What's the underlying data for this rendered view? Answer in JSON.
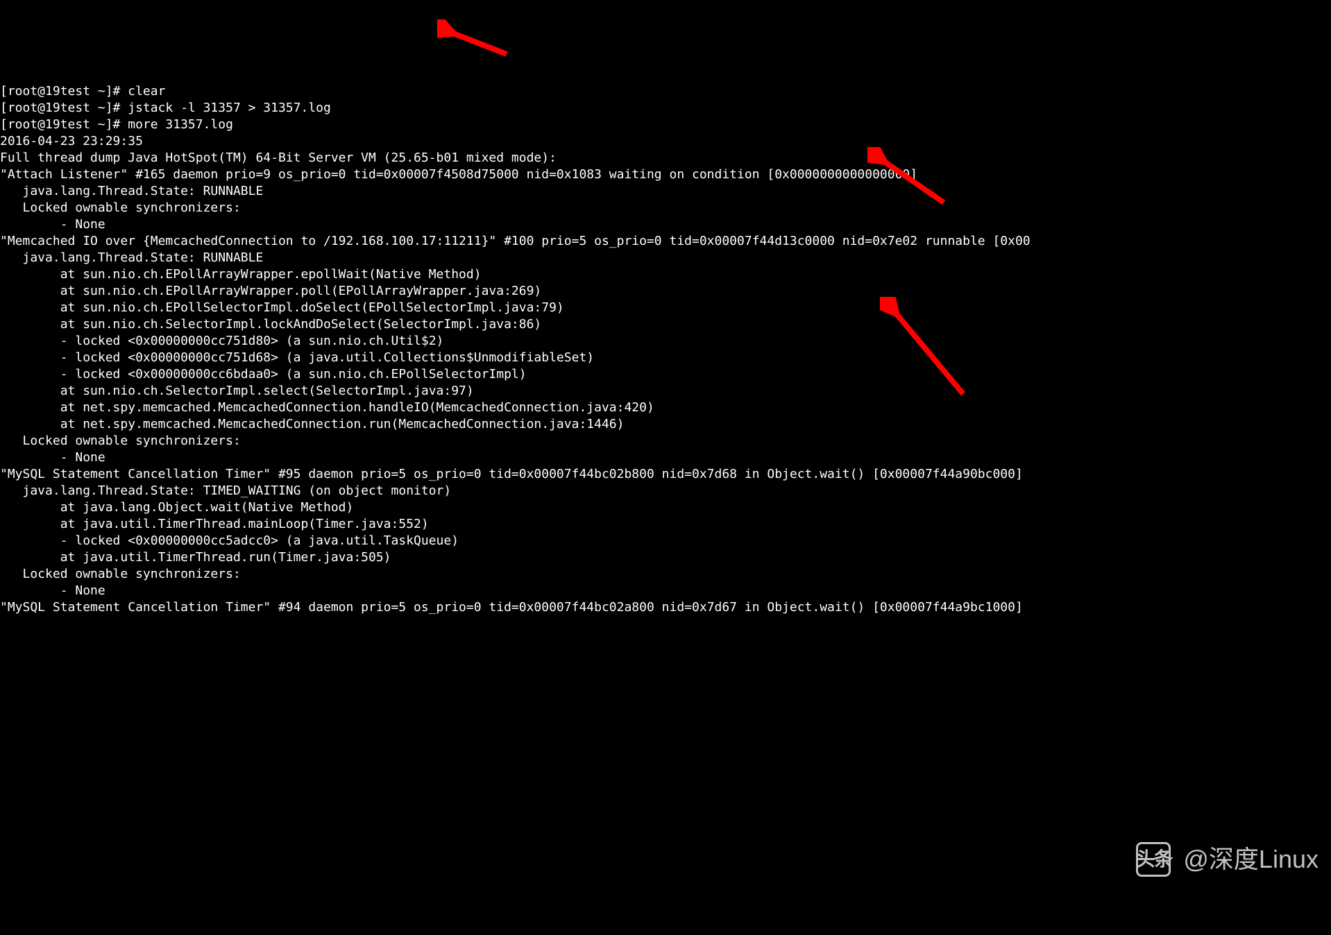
{
  "terminal": {
    "lines": [
      "[root@19test ~]# clear",
      "[root@19test ~]# jstack -l 31357 > 31357.log",
      "[root@19test ~]# more 31357.log",
      "2016-04-23 23:29:35",
      "Full thread dump Java HotSpot(TM) 64-Bit Server VM (25.65-b01 mixed mode):",
      "",
      "\"Attach Listener\" #165 daemon prio=9 os_prio=0 tid=0x00007f4508d75000 nid=0x1083 waiting on condition [0x0000000000000000]",
      "   java.lang.Thread.State: RUNNABLE",
      "",
      "   Locked ownable synchronizers:",
      "        - None",
      "",
      "\"Memcached IO over {MemcachedConnection to /192.168.100.17:11211}\" #100 prio=5 os_prio=0 tid=0x00007f44d13c0000 nid=0x7e02 runnable [0x00",
      "   java.lang.Thread.State: RUNNABLE",
      "        at sun.nio.ch.EPollArrayWrapper.epollWait(Native Method)",
      "        at sun.nio.ch.EPollArrayWrapper.poll(EPollArrayWrapper.java:269)",
      "        at sun.nio.ch.EPollSelectorImpl.doSelect(EPollSelectorImpl.java:79)",
      "        at sun.nio.ch.SelectorImpl.lockAndDoSelect(SelectorImpl.java:86)",
      "        - locked <0x00000000cc751d80> (a sun.nio.ch.Util$2)",
      "        - locked <0x00000000cc751d68> (a java.util.Collections$UnmodifiableSet)",
      "        - locked <0x00000000cc6bdaa0> (a sun.nio.ch.EPollSelectorImpl)",
      "        at sun.nio.ch.SelectorImpl.select(SelectorImpl.java:97)",
      "        at net.spy.memcached.MemcachedConnection.handleIO(MemcachedConnection.java:420)",
      "        at net.spy.memcached.MemcachedConnection.run(MemcachedConnection.java:1446)",
      "",
      "   Locked ownable synchronizers:",
      "        - None",
      "",
      "\"MySQL Statement Cancellation Timer\" #95 daemon prio=5 os_prio=0 tid=0x00007f44bc02b800 nid=0x7d68 in Object.wait() [0x00007f44a90bc000]",
      "   java.lang.Thread.State: TIMED_WAITING (on object monitor)",
      "        at java.lang.Object.wait(Native Method)",
      "        at java.util.TimerThread.mainLoop(Timer.java:552)",
      "        - locked <0x00000000cc5adcc0> (a java.util.TaskQueue)",
      "        at java.util.TimerThread.run(Timer.java:505)",
      "",
      "   Locked ownable synchronizers:",
      "        - None",
      "",
      "\"MySQL Statement Cancellation Timer\" #94 daemon prio=5 os_prio=0 tid=0x00007f44bc02a800 nid=0x7d67 in Object.wait() [0x00007f44a9bc1000]"
    ]
  },
  "watermark": {
    "logo_text": "头条",
    "handle": "@深度Linux"
  },
  "annotations": {
    "arrow_color": "#ff0000"
  }
}
